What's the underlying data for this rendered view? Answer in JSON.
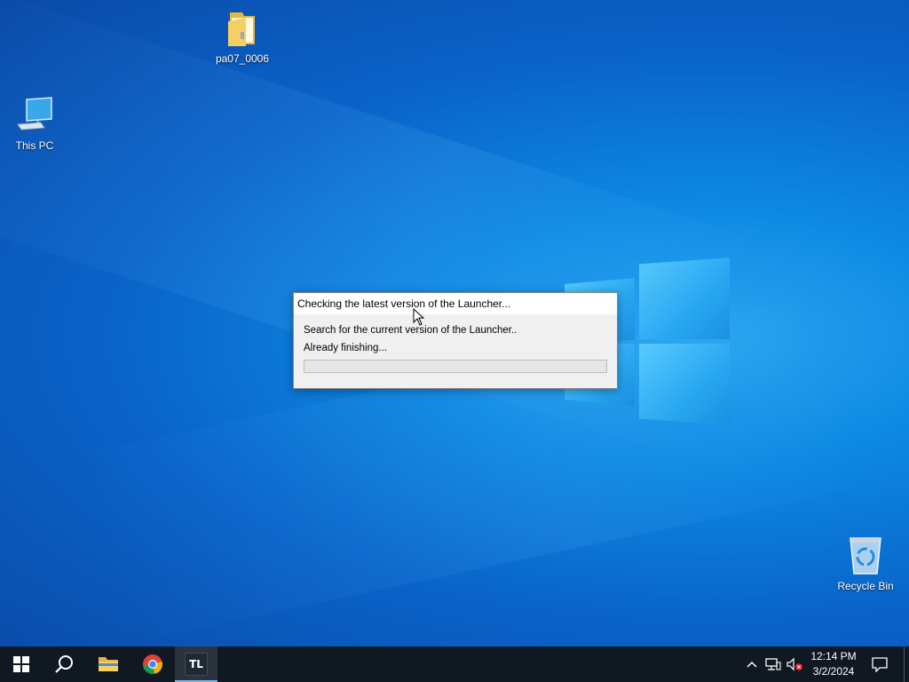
{
  "desktop": {
    "icons": [
      {
        "label": "pa07_0006",
        "icon": "folder-icon"
      },
      {
        "label": "This PC",
        "icon": "computer-icon"
      },
      {
        "label": "Recycle Bin",
        "icon": "recycle-bin-icon"
      }
    ]
  },
  "dialog": {
    "title": "Checking the latest version of the Launcher...",
    "line1": "Search for the current version of the Launcher..",
    "line2": "Already finishing...",
    "progress": 0
  },
  "taskbar": {
    "buttons": [
      {
        "name": "start-button",
        "icon": "windows-logo-icon"
      },
      {
        "name": "search-button",
        "icon": "search-icon"
      },
      {
        "name": "file-explorer-button",
        "icon": "folder-icon"
      },
      {
        "name": "chrome-button",
        "icon": "chrome-icon"
      },
      {
        "name": "launcher-button",
        "icon": "tl-app-icon",
        "text": "TL"
      }
    ],
    "tray": {
      "time": "12:14 PM",
      "date": "3/2/2024",
      "icons": [
        "chevron-up-icon",
        "network-icon",
        "volume-muted-icon",
        "notification-icon"
      ]
    }
  },
  "colors": {
    "taskbar_bg": "#101822",
    "desktop_accent": "#0c88e3",
    "active_indicator": "#76b9ed"
  }
}
